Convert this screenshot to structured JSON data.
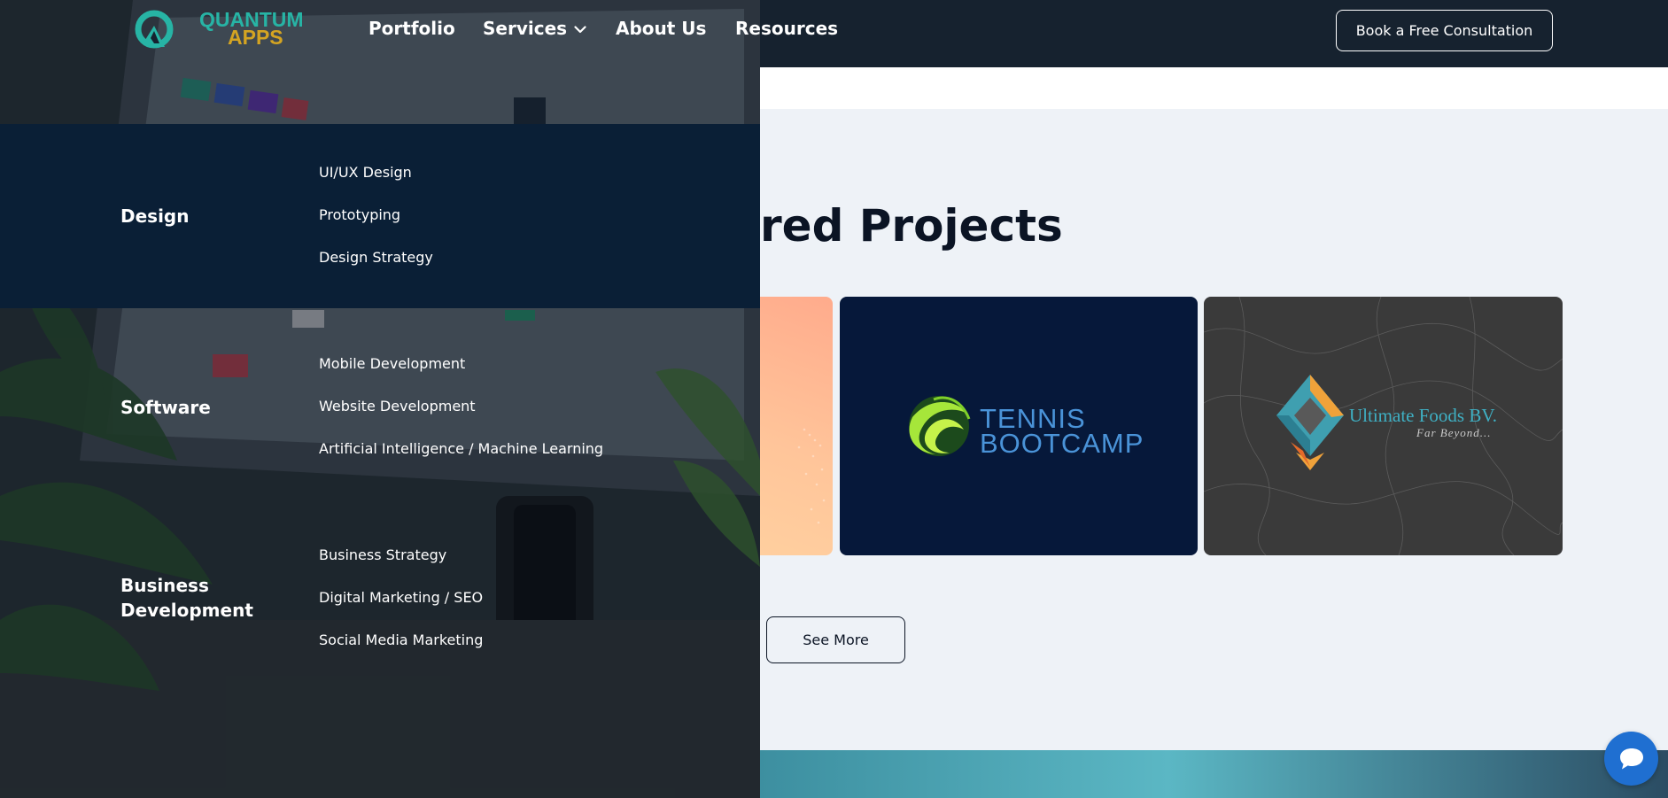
{
  "header": {
    "logo_line1": "QUANTUM",
    "logo_line2": "APPS",
    "nav": {
      "portfolio": "Portfolio",
      "services": "Services",
      "about": "About Us",
      "resources": "Resources"
    },
    "cta_label": "Book a Free Consultation"
  },
  "mega_menu": {
    "categories": [
      {
        "label": "Design",
        "items": [
          "UI/UX Design",
          "Prototyping",
          "Design Strategy"
        ]
      },
      {
        "label": "Software",
        "items": [
          "Mobile Development",
          "Website Development",
          "Artificial Intelligence / Machine Learning"
        ]
      },
      {
        "label": "Business Development",
        "items": [
          "Business Strategy",
          "Digital Marketing / SEO",
          "Social Media Marketing"
        ]
      }
    ]
  },
  "main": {
    "section_title": "Featured Projects",
    "visible_title": "red Projects",
    "cards": [
      {
        "name": "peach-card"
      },
      {
        "name": "tennis-bootcamp",
        "logo_line1": "TENNIS",
        "logo_line2": "BOOTCAMP"
      },
      {
        "name": "ultimate-foods",
        "logo_name": "Ultimate Foods BV.",
        "logo_tagline": "Far Beyond..."
      }
    ],
    "see_more_label": "See More"
  },
  "colors": {
    "header_bg": "#16222f",
    "menu_band": "#0a1f36",
    "page_bg": "#eef2f7",
    "tennis_bg": "#06183a",
    "accent_blue": "#1f6fd1",
    "logo_gold": "#d4a422",
    "logo_teal": "#27b4a5"
  },
  "icons": {
    "chevron": "chevron-down-icon",
    "chat": "chat-bubble-icon"
  }
}
